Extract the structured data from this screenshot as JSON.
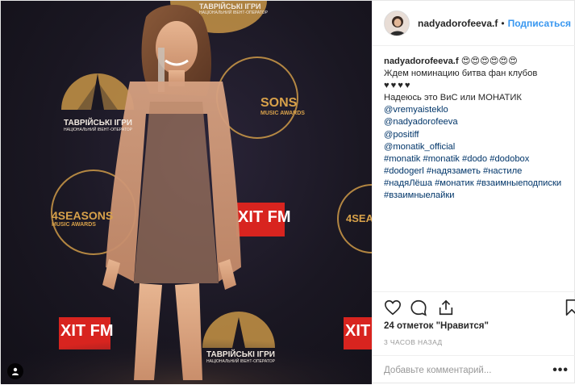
{
  "header": {
    "username": "nadyadorofeeva.f",
    "dot": "•",
    "follow_label": "Подписаться"
  },
  "caption": {
    "username": "nadyadorofeeva.f",
    "emoji": "😍😍😍😍😍😍",
    "line1": "Ждем номинацию битва фан клубов",
    "hearts": "♥♥♥♥",
    "line2": "Надеюсь это ВиС или МОНАТИК",
    "mentions": [
      "@vremyaisteklo",
      "@nadyadorofeeva",
      "@positiff",
      "@monatik_official"
    ],
    "hashtag_lines": [
      "#monatik #monatik #dodo #dodobox",
      "#dodogerl #надязаметь #настиле",
      "#надяЛёша #монатик #взаимныеподписки",
      "#взаимныелайки"
    ]
  },
  "photo": {
    "backdrop_texts": {
      "brand_left": "ТАВРІЙСЬКІ ІГРИ",
      "brand_left_sub": "НАЦІОНАЛЬНИЙ ІВЕНТ-ОПЕРАТОР",
      "brand_top": "ТАВРІЙСЬКІ ІГРИ",
      "brand_top_sub": "НАЦІОНАЛЬНИЙ ІВЕНТ-ОПЕРАТОР",
      "seasons_right": "SONS",
      "seasons_right_sub": "MUSIC AWARDS",
      "seasons_left": "4SEASONS",
      "seasons_left_sub": "MUSIC AWARDS",
      "radio_left": "ХІТ FM",
      "radio_right": "ХІТ FM",
      "radio_bottom_left": "ХІТ FM",
      "radio_bottom_right": "ХІТ",
      "brand_bottom": "ТАВРІЙСЬКІ ІГРИ",
      "brand_bottom_sub": "НАЦІОНАЛЬНИЙ ІВЕНТ-ОПЕРАТОР",
      "seasons_mid_right": "4SEA"
    }
  },
  "footer": {
    "likes": "24 отметок \"Нравится\"",
    "time": "3 ЧАСОВ НАЗАД",
    "comment_placeholder": "Добавьте комментарий...",
    "more_icon": "ellipsis-icon",
    "more_label": "•••"
  },
  "icons": {
    "like": "heart-icon",
    "comment": "comment-icon",
    "share": "share-icon",
    "save": "bookmark-icon",
    "tag": "user-tag-icon"
  },
  "colors": {
    "accent": "#3897f0",
    "link": "#003569",
    "backdrop": "#1a1722",
    "gold": "#d9a24a",
    "red_logo": "#d8241f"
  }
}
